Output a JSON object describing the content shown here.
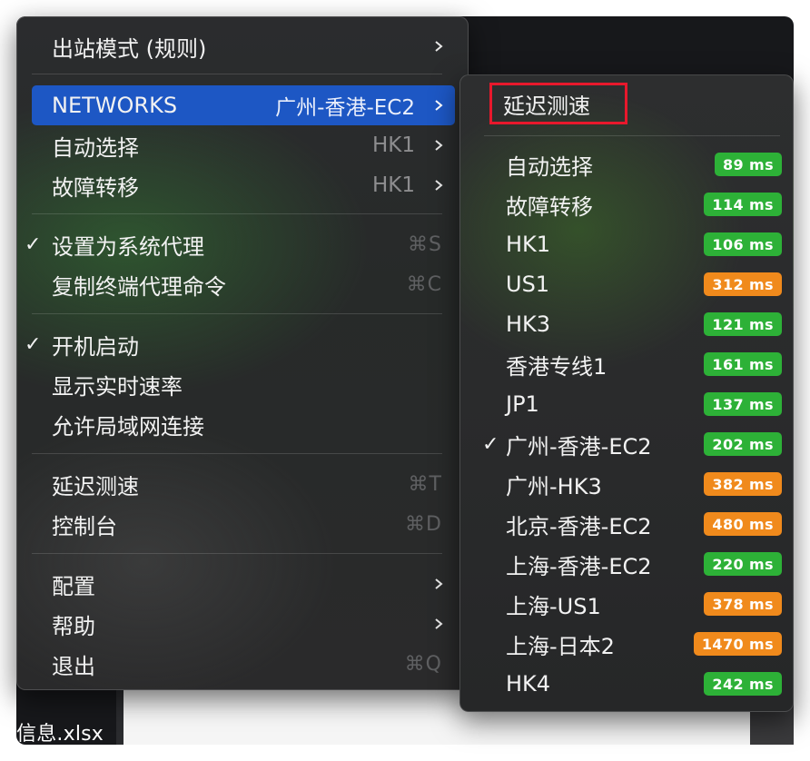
{
  "background": {
    "file_label": "信息.xlsx"
  },
  "main_menu": {
    "outbound_mode": "出站模式 (规则)",
    "networks": {
      "label": "NETWORKS",
      "detail": "广州-香港-EC2"
    },
    "auto_select": {
      "label": "自动选择",
      "detail": "HK1"
    },
    "failover": {
      "label": "故障转移",
      "detail": "HK1"
    },
    "set_system_proxy": {
      "label": "设置为系统代理",
      "shortcut": "⌘S",
      "checked": true
    },
    "copy_terminal_cmd": {
      "label": "复制终端代理命令",
      "shortcut": "⌘C"
    },
    "launch_at_login": {
      "label": "开机启动",
      "checked": true
    },
    "show_speed": {
      "label": "显示实时速率"
    },
    "allow_lan": {
      "label": "允许局域网连接"
    },
    "latency_test": {
      "label": "延迟测速",
      "shortcut": "⌘T"
    },
    "dashboard": {
      "label": "控制台",
      "shortcut": "⌘D"
    },
    "config": {
      "label": "配置"
    },
    "help": {
      "label": "帮助"
    },
    "quit": {
      "label": "退出",
      "shortcut": "⌘Q"
    }
  },
  "sub_menu": {
    "latency_test": "延迟测速",
    "proxies": [
      {
        "name": "自动选择",
        "latency": "89 ms",
        "status": "good"
      },
      {
        "name": "故障转移",
        "latency": "114 ms",
        "status": "good"
      },
      {
        "name": "HK1",
        "latency": "106 ms",
        "status": "good"
      },
      {
        "name": "US1",
        "latency": "312 ms",
        "status": "slow"
      },
      {
        "name": "HK3",
        "latency": "121 ms",
        "status": "good"
      },
      {
        "name": "香港专线1",
        "latency": "161 ms",
        "status": "good"
      },
      {
        "name": "JP1",
        "latency": "137 ms",
        "status": "good"
      },
      {
        "name": "广州-香港-EC2",
        "latency": "202 ms",
        "status": "good",
        "selected": true
      },
      {
        "name": "广州-HK3",
        "latency": "382 ms",
        "status": "slow"
      },
      {
        "name": "北京-香港-EC2",
        "latency": "480 ms",
        "status": "slow"
      },
      {
        "name": "上海-香港-EC2",
        "latency": "220 ms",
        "status": "good"
      },
      {
        "name": "上海-US1",
        "latency": "378 ms",
        "status": "slow"
      },
      {
        "name": "上海-日本2",
        "latency": "1470 ms",
        "status": "slow"
      },
      {
        "name": "HK4",
        "latency": "242 ms",
        "status": "good"
      }
    ]
  },
  "colors": {
    "highlight": "#1d57c4",
    "good": "#2db137",
    "slow": "#f08a1c",
    "annotation_box": "#e8182c"
  },
  "check_glyph": "✓"
}
